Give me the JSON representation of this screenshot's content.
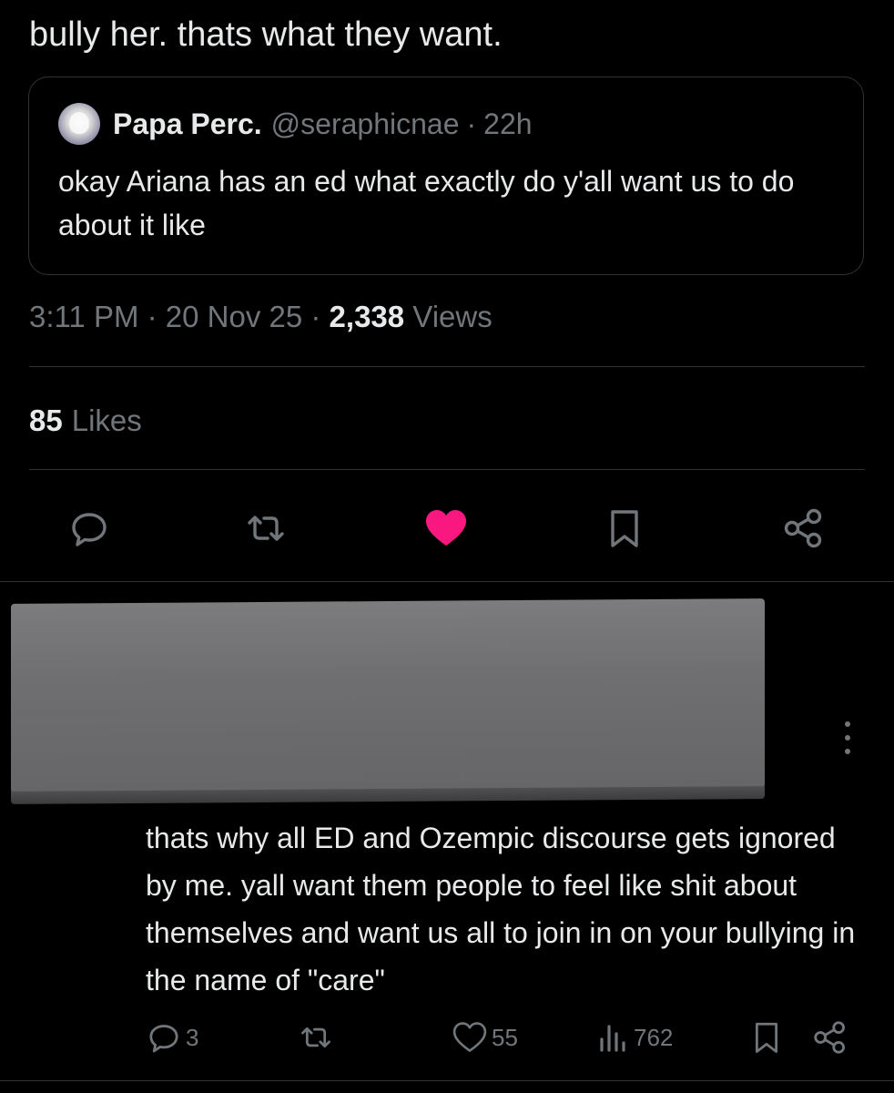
{
  "tweet": {
    "text": "bully her. thats what they want.",
    "quote": {
      "name": "Papa Perc.",
      "handle": "@seraphicnae",
      "separator": "·",
      "time": "22h",
      "text": "okay Ariana has an ed what exactly do y'all want us to do about it like"
    },
    "meta": {
      "time": "3:11 PM",
      "sep1": " · ",
      "date": "20 Nov 25",
      "sep2": " · ",
      "views_count": "2,338",
      "views_label": " Views"
    },
    "likes": {
      "count": "85",
      "label": "Likes"
    },
    "actions": {
      "reply_icon": "reply-icon",
      "repost_icon": "repost-icon",
      "like_icon": "heart-filled-icon",
      "bookmark_icon": "bookmark-icon",
      "share_icon": "share-icon",
      "like_color": "#f91880"
    }
  },
  "reply": {
    "text": "thats why all ED and Ozempic discourse gets ignored by me. yall want them people to feel like shit about themselves and want us all to join in on your bullying in the name of \"care\"",
    "reply_count": "3",
    "like_count": "55",
    "views_count": "762"
  },
  "colors": {
    "background": "#000000",
    "text": "#e7e9ea",
    "muted": "#71767b",
    "border": "#2f3336",
    "redaction": "#727274"
  }
}
